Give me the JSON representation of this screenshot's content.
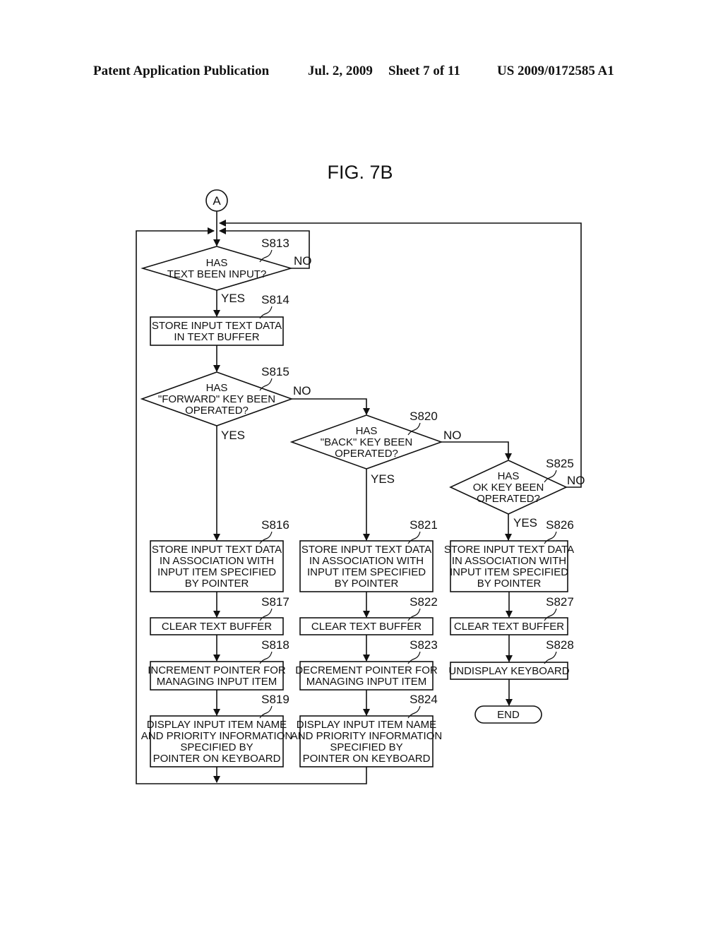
{
  "header": {
    "publication": "Patent Application Publication",
    "date": "Jul. 2, 2009",
    "sheet": "Sheet 7 of 11",
    "number": "US 2009/0172585 A1"
  },
  "figure": {
    "title": "FIG. 7B",
    "connector": "A"
  },
  "nodes": {
    "s813": {
      "step": "S813",
      "type": "decision",
      "lines": [
        "HAS",
        "TEXT BEEN INPUT?"
      ],
      "yes": "YES",
      "no": "NO"
    },
    "s814": {
      "step": "S814",
      "type": "process",
      "lines": [
        "STORE INPUT TEXT DATA",
        "IN TEXT BUFFER"
      ]
    },
    "s815": {
      "step": "S815",
      "type": "decision",
      "lines": [
        "HAS",
        "\"FORWARD\" KEY BEEN",
        "OPERATED?"
      ],
      "yes": "YES",
      "no": "NO"
    },
    "s816": {
      "step": "S816",
      "type": "process",
      "lines": [
        "STORE INPUT TEXT DATA",
        "IN ASSOCIATION WITH",
        "INPUT ITEM SPECIFIED",
        "BY POINTER"
      ]
    },
    "s817": {
      "step": "S817",
      "type": "process",
      "lines": [
        "CLEAR TEXT BUFFER"
      ]
    },
    "s818": {
      "step": "S818",
      "type": "process",
      "lines": [
        "INCREMENT POINTER FOR",
        "MANAGING INPUT ITEM"
      ]
    },
    "s819": {
      "step": "S819",
      "type": "process",
      "lines": [
        "DISPLAY INPUT ITEM NAME",
        "AND PRIORITY INFORMATION",
        "SPECIFIED BY",
        "POINTER ON KEYBOARD"
      ]
    },
    "s820": {
      "step": "S820",
      "type": "decision",
      "lines": [
        "HAS",
        "\"BACK\" KEY BEEN",
        "OPERATED?"
      ],
      "yes": "YES",
      "no": "NO"
    },
    "s821": {
      "step": "S821",
      "type": "process",
      "lines": [
        "STORE INPUT TEXT DATA",
        "IN ASSOCIATION WITH",
        "INPUT ITEM SPECIFIED",
        "BY POINTER"
      ]
    },
    "s822": {
      "step": "S822",
      "type": "process",
      "lines": [
        "CLEAR TEXT BUFFER"
      ]
    },
    "s823": {
      "step": "S823",
      "type": "process",
      "lines": [
        "DECREMENT POINTER FOR",
        "MANAGING INPUT ITEM"
      ]
    },
    "s824": {
      "step": "S824",
      "type": "process",
      "lines": [
        "DISPLAY INPUT ITEM NAME",
        "AND PRIORITY INFORMATION",
        "SPECIFIED BY",
        "POINTER ON KEYBOARD"
      ]
    },
    "s825": {
      "step": "S825",
      "type": "decision",
      "lines": [
        "HAS",
        "OK KEY BEEN",
        "OPERATED?"
      ],
      "yes": "YES",
      "no": "NO"
    },
    "s826": {
      "step": "S826",
      "type": "process",
      "lines": [
        "STORE INPUT TEXT DATA",
        "IN ASSOCIATION WITH",
        "INPUT ITEM SPECIFIED",
        "BY POINTER"
      ]
    },
    "s827": {
      "step": "S827",
      "type": "process",
      "lines": [
        "CLEAR TEXT BUFFER"
      ]
    },
    "s828": {
      "step": "S828",
      "type": "process",
      "lines": [
        "UNDISPLAY KEYBOARD"
      ]
    },
    "end": {
      "type": "terminal",
      "lines": [
        "END"
      ]
    }
  }
}
